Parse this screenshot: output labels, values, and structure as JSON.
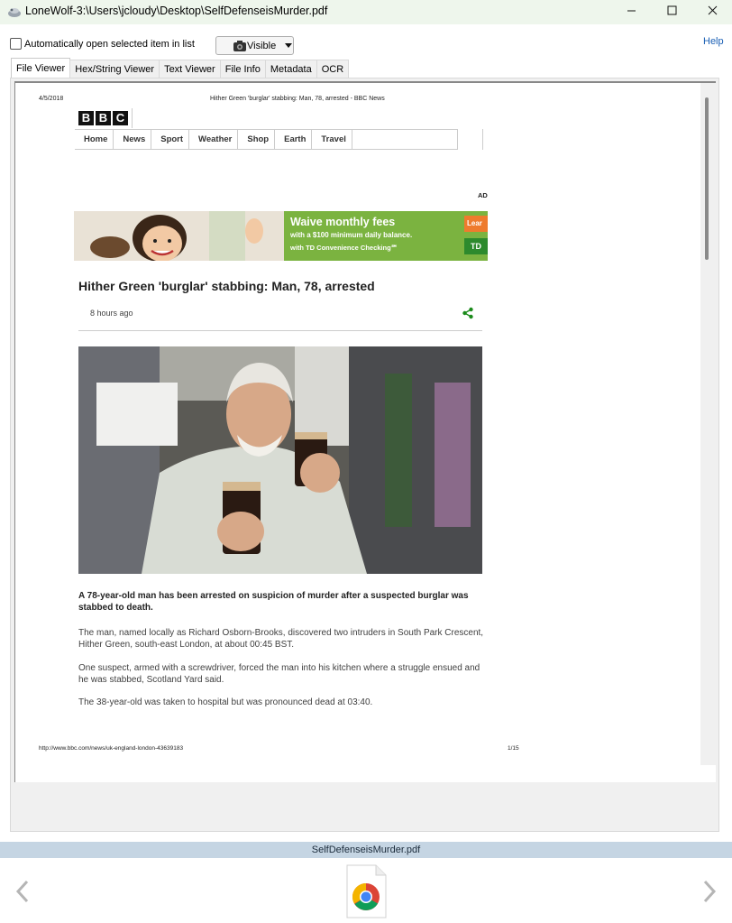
{
  "window": {
    "title": "LoneWolf-3:\\Users\\jcloudy\\Desktop\\SelfDefenseisMurder.pdf",
    "minimize_icon": "minimize-icon",
    "maximize_icon": "maximize-icon",
    "close_icon": "close-icon"
  },
  "toolbar": {
    "auto_open_label": "Automatically open selected item in list",
    "auto_open_checked": false,
    "visibility_label": "Visible",
    "help_label": "Help"
  },
  "tabs": [
    {
      "label": "File Viewer",
      "active": true
    },
    {
      "label": "Hex/String Viewer",
      "active": false
    },
    {
      "label": "Text Viewer",
      "active": false
    },
    {
      "label": "File Info",
      "active": false
    },
    {
      "label": "Metadata",
      "active": false
    },
    {
      "label": "OCR",
      "active": false
    }
  ],
  "pdf": {
    "header_date": "4/5/2018",
    "header_title": "Hither Green 'burglar' stabbing: Man, 78, arrested - BBC News",
    "logo_letters": [
      "B",
      "B",
      "C"
    ],
    "nav_items": [
      "Home",
      "News",
      "Sport",
      "Weather",
      "Shop",
      "Earth",
      "Travel"
    ],
    "ad_label": "AD",
    "ad": {
      "headline": "Waive monthly fees",
      "sub1": "with a $100 minimum daily balance.",
      "sub2": "with TD Convenience Checking℠",
      "orange_text": "Lear",
      "td_logo": "TD"
    },
    "headline": "Hither Green 'burglar' stabbing: Man, 78, arrested",
    "timestamp": "8 hours ago",
    "paragraphs": [
      "A 78-year-old man has been arrested on suspicion of murder after a suspected burglar was stabbed to death.",
      "The man, named locally as Richard Osborn-Brooks, discovered two intruders in South Park Crescent, Hither Green, south-east London, at about 00:45 BST.",
      "One suspect, armed with a screwdriver, forced the man into his kitchen where a struggle ensued and he was stabbed, Scotland Yard said.",
      "The 38-year-old was taken to hospital but was pronounced dead at 03:40."
    ],
    "footer_url": "http://www.bbc.com/news/uk-england-london-43639183",
    "footer_page": "1/15"
  },
  "status": {
    "filename": "SelfDefenseisMurder.pdf"
  },
  "colors": {
    "titlebar_bg": "#eef6ec",
    "status_bar_bg": "#c5d5e3",
    "help_link": "#1a5fb4",
    "ad_green": "#7bb340",
    "share_green": "#1a8a1a"
  }
}
